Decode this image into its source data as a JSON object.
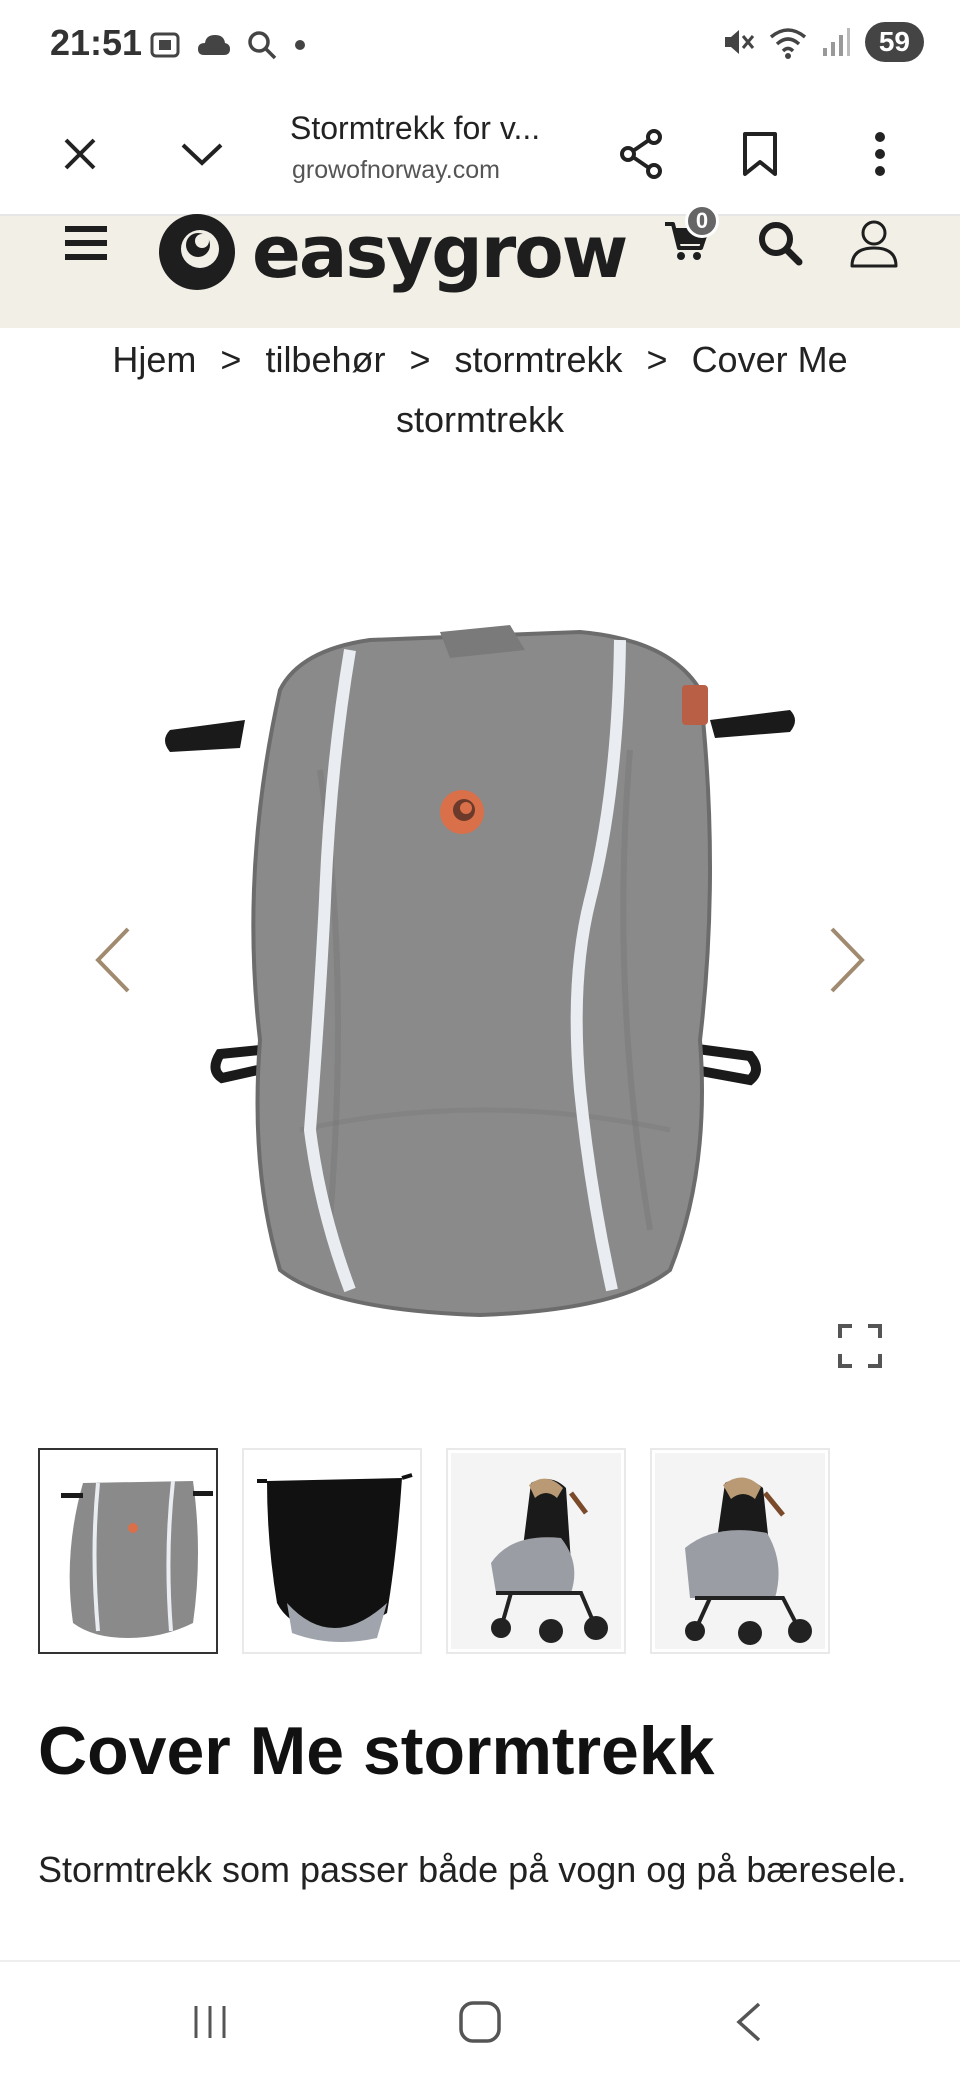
{
  "status_bar": {
    "time": "21:51",
    "battery": "59",
    "icons_left": [
      "screenshot-icon",
      "cloud-icon",
      "search-icon",
      "dot-icon"
    ],
    "icons_right": [
      "mute-icon",
      "wifi-icon",
      "signal-icon"
    ]
  },
  "browser": {
    "title": "Stormtrekk for v...",
    "url": "growofnorway.com"
  },
  "site": {
    "brand": "easygrow",
    "cart_count": "0"
  },
  "breadcrumb": {
    "items": [
      "Hjem",
      "tilbehør",
      "stormtrekk",
      "Cover Me stormtrekk"
    ],
    "separator": ">"
  },
  "product": {
    "title": "Cover Me stormtrekk",
    "description": "Stormtrekk som passer både på vogn og på bæresele.",
    "thumbnail_count": 4,
    "active_thumbnail": 1
  },
  "colors": {
    "header_bg": "#f2efe7",
    "fabric_grey": "#8a8a8a",
    "accent_orange": "#d9704a"
  }
}
